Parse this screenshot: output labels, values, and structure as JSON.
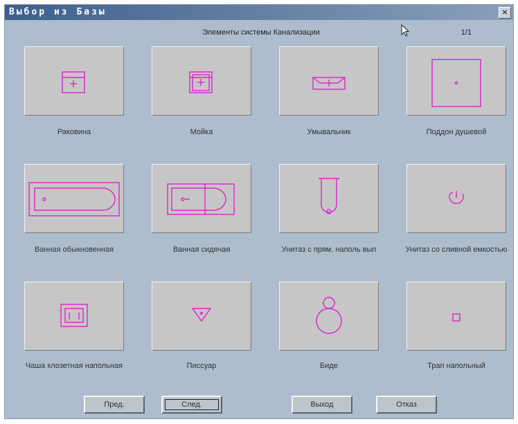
{
  "window": {
    "title": "Выбор из Базы",
    "close_glyph": "×"
  },
  "header": {
    "title": "Элементы системы Канализации",
    "page_indicator": "1/1"
  },
  "items": [
    {
      "label": "Раковина",
      "icon": "sink-symbol-icon"
    },
    {
      "label": "Мойка",
      "icon": "kitchen-sink-symbol-icon"
    },
    {
      "label": "Умывальник",
      "icon": "washbasin-symbol-icon"
    },
    {
      "label": "Поддон душевой",
      "icon": "shower-tray-symbol-icon"
    },
    {
      "label": "Ванная обыкновенная",
      "icon": "bathtub-symbol-icon"
    },
    {
      "label": "Ванная сидячая",
      "icon": "sitting-bath-symbol-icon"
    },
    {
      "label": "Унитаз с прям. наполь вып",
      "icon": "toilet-straight-outlet-symbol-icon"
    },
    {
      "label": "Унитаз со сливной емкостью",
      "icon": "toilet-cistern-symbol-icon"
    },
    {
      "label": "Чаша клозетная напольная",
      "icon": "floor-bowl-symbol-icon"
    },
    {
      "label": "Писсуар",
      "icon": "urinal-symbol-icon"
    },
    {
      "label": "Биде",
      "icon": "bidet-symbol-icon"
    },
    {
      "label": "Трап напольный",
      "icon": "floor-drain-symbol-icon"
    }
  ],
  "buttons": {
    "prev": "Пред.",
    "next": "След.",
    "exit": "Выход",
    "cancel": "Отказ"
  },
  "colors": {
    "window_bg": "#aebdce",
    "tile_bg": "#c6c6c6",
    "symbol": "#e020d0"
  }
}
